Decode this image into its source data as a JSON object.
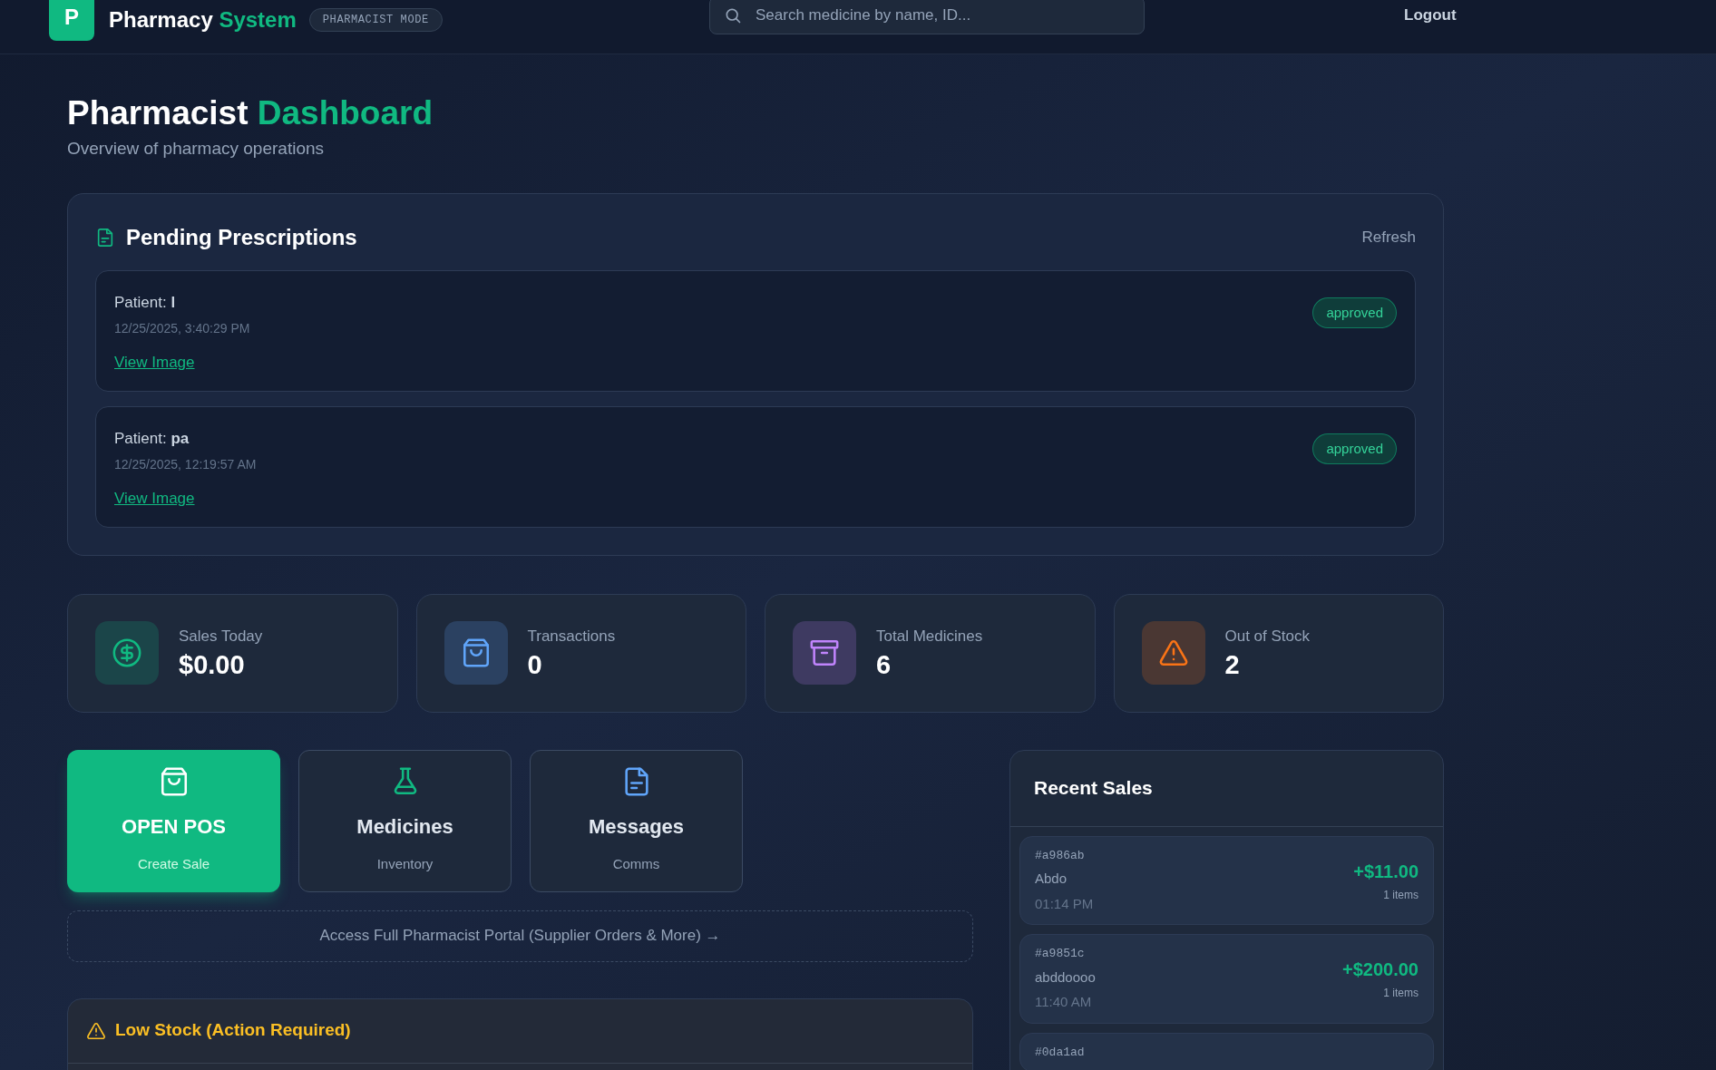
{
  "header": {
    "logo_letter": "P",
    "brand": "Pharmacy **System**",
    "mode_badge": "PHARMACIST MODE",
    "search": {
      "placeholder": "Search medicine by name, ID..."
    },
    "logout": "Logout"
  },
  "page": {
    "title": "Pharmacist **Dashboard**",
    "subtitle": "Overview of pharmacy operations"
  },
  "prescriptions": {
    "title": "Pending Prescriptions",
    "refresh": "Refresh",
    "items": [
      {
        "patient": "Patient: **l**",
        "time": "12/25/2025, 3:40:29 PM",
        "link": "View Image",
        "status": "approved"
      },
      {
        "patient": "Patient: **pa**",
        "time": "12/25/2025, 12:19:57 AM",
        "link": "View Image",
        "status": "approved"
      }
    ]
  },
  "stats": [
    {
      "kind": "dollar",
      "color": "#10b981",
      "label": "Sales Today",
      "value": "$0.00"
    },
    {
      "kind": "bag",
      "color": "#60a5fa",
      "label": "Transactions",
      "value": "0"
    },
    {
      "kind": "box",
      "color": "#c084fc",
      "label": "Total Medicines",
      "value": "6"
    },
    {
      "kind": "alert",
      "color": "#f97316",
      "label": "Out of Stock",
      "value": "2"
    }
  ],
  "actions": [
    {
      "kind": "bag",
      "primary": true,
      "title": "OPEN POS",
      "subtitle": "Create Sale"
    },
    {
      "kind": "flask",
      "primary": false,
      "title": "Medicines",
      "subtitle": "Inventory"
    },
    {
      "kind": "file",
      "primary": false,
      "title": "Messages",
      "subtitle": "Comms"
    }
  ],
  "portal_link": "Access Full Pharmacist Portal (Supplier Orders & More) →",
  "low_stock": {
    "title": "Low Stock (Action Required)"
  },
  "recent_sales": {
    "title": "Recent Sales",
    "items": [
      {
        "id": "#a986ab",
        "customer": "Abdo",
        "time": "01:14 PM",
        "amount": "+$11.00",
        "items": "1 items"
      },
      {
        "id": "#a9851c",
        "customer": "abddoooo",
        "time": "11:40 AM",
        "amount": "+$200.00",
        "items": "1 items"
      },
      {
        "id": "#0da1ad"
      }
    ]
  }
}
